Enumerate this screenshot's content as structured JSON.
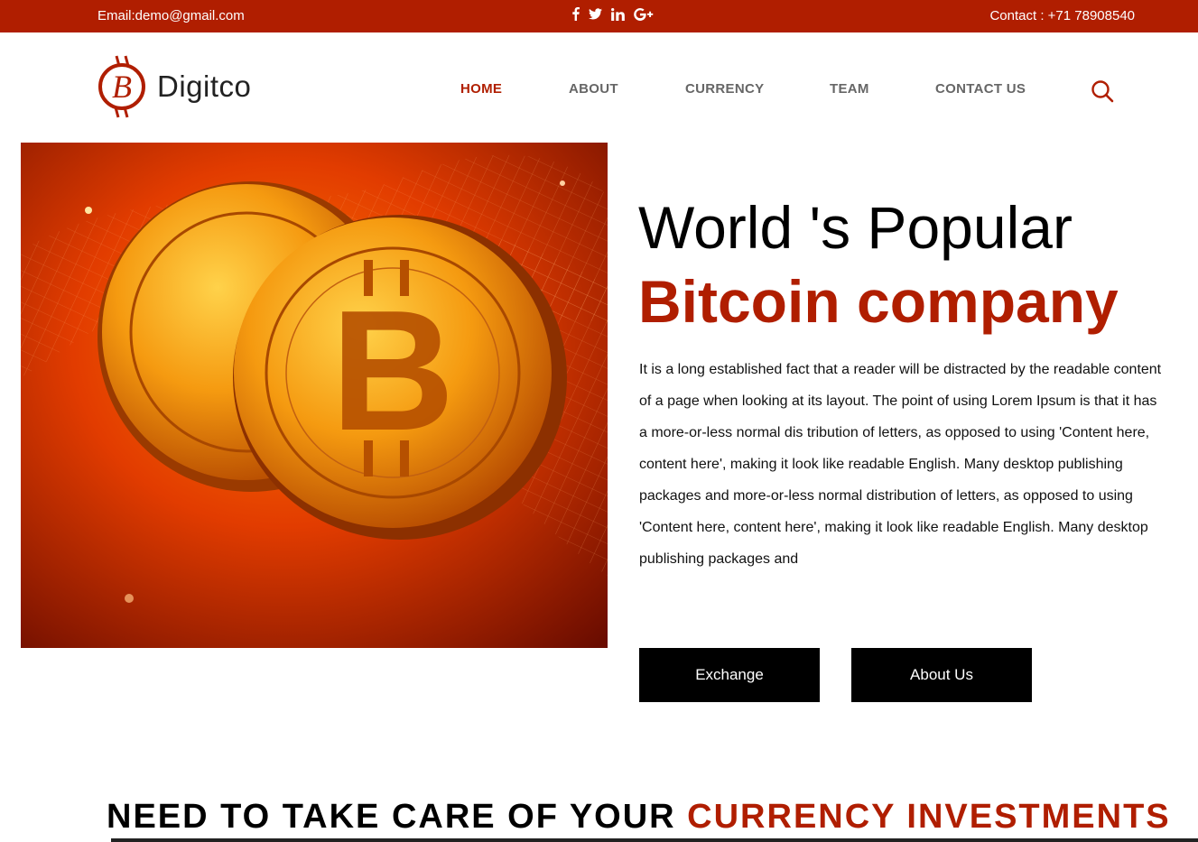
{
  "topbar": {
    "email": "Email:demo@gmail.com",
    "contact": "Contact : +71 78908540",
    "social_icons": [
      "facebook-icon",
      "twitter-icon",
      "linkedin-icon",
      "google-plus-icon"
    ]
  },
  "header": {
    "logo_text": "Digitco",
    "nav": [
      {
        "label": "HOME",
        "active": true
      },
      {
        "label": "ABOUT",
        "active": false
      },
      {
        "label": "CURRENCY",
        "active": false
      },
      {
        "label": "TEAM",
        "active": false
      },
      {
        "label": "CONTACT US",
        "active": false
      }
    ],
    "search_icon": "search-icon"
  },
  "hero": {
    "title_line1": "World 's Popular",
    "title_line2": "Bitcoin company",
    "paragraph": "It is a long established fact that a reader will be distracted by the readable content of a page when looking at its layout. The point of using Lorem Ipsum is that it has a more-or-less normal dis tribution of letters, as opposed to using 'Content here, content here', making it look like readable English. Many desktop publishing packages and more-or-less normal distribution of letters, as opposed to using 'Content here, content here', making it look like readable English. Many desktop publishing packages and",
    "buttons": {
      "exchange": "Exchange",
      "about": "About Us"
    }
  },
  "section": {
    "title_part1": "NEED TO TAKE CARE OF YOUR ",
    "title_part2": "CURRENCY INVESTMENTS"
  },
  "colors": {
    "brand": "#b01e00",
    "button": "#000000",
    "nav_inactive": "#666666"
  }
}
